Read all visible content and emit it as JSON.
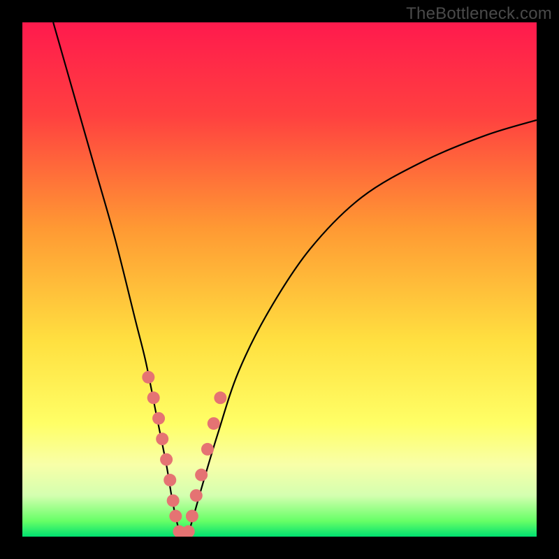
{
  "watermark": "TheBottleneck.com",
  "colors": {
    "gradient_stops": [
      {
        "pct": 0,
        "hex": "#ff1a4d"
      },
      {
        "pct": 18,
        "hex": "#ff4040"
      },
      {
        "pct": 40,
        "hex": "#ff9933"
      },
      {
        "pct": 62,
        "hex": "#ffe040"
      },
      {
        "pct": 78,
        "hex": "#ffff66"
      },
      {
        "pct": 86,
        "hex": "#f8ffa8"
      },
      {
        "pct": 92,
        "hex": "#d4ffb0"
      },
      {
        "pct": 97,
        "hex": "#66ff66"
      },
      {
        "pct": 100,
        "hex": "#00e070"
      }
    ],
    "curve": "#000000",
    "marker": "#e57373",
    "frame": "#000000"
  },
  "chart_data": {
    "type": "line",
    "title": "",
    "xlabel": "",
    "ylabel": "",
    "xlim": [
      0,
      100
    ],
    "ylim": [
      0,
      100
    ],
    "grid": false,
    "legend": false,
    "series": [
      {
        "name": "bottleneck-curve",
        "x": [
          6,
          10,
          14,
          18,
          22,
          24,
          26,
          28,
          29,
          30,
          31,
          32,
          33,
          35,
          38,
          42,
          48,
          56,
          66,
          78,
          90,
          100
        ],
        "y": [
          100,
          86,
          72,
          58,
          42,
          34,
          24,
          14,
          8,
          3,
          0,
          0,
          3,
          10,
          20,
          32,
          44,
          56,
          66,
          73,
          78,
          81
        ]
      }
    ],
    "markers": {
      "name": "highlighted-points",
      "x": [
        24.5,
        25.5,
        26.5,
        27.2,
        28.0,
        28.7,
        29.3,
        29.8,
        30.5,
        31.5,
        32.3,
        33.0,
        33.8,
        34.8,
        36.0,
        37.2,
        38.5
      ],
      "y": [
        31,
        27,
        23,
        19,
        15,
        11,
        7,
        4,
        1,
        0,
        1,
        4,
        8,
        12,
        17,
        22,
        27
      ]
    },
    "minimum_x": 31
  }
}
